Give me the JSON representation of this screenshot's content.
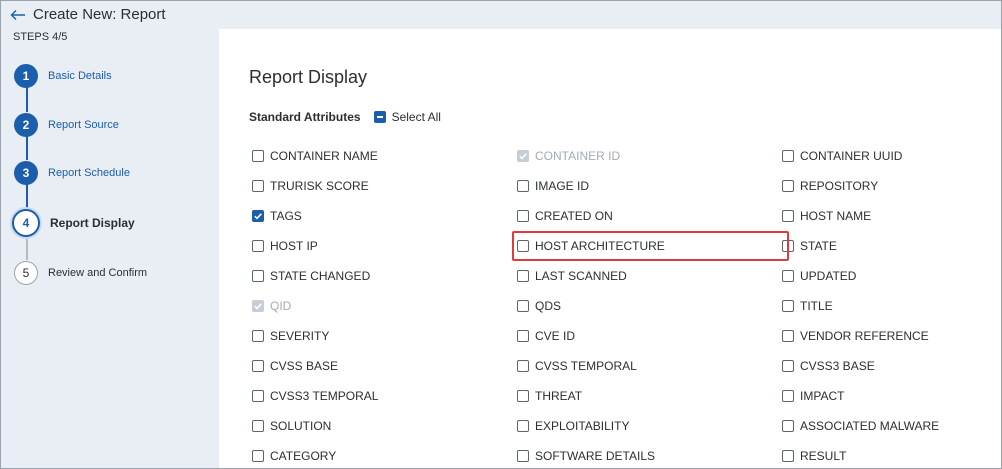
{
  "header": {
    "title": "Create New: Report"
  },
  "sidebar": {
    "steps_label": "STEPS 4/5",
    "steps": [
      {
        "num": "1",
        "label": "Basic Details",
        "state": "done"
      },
      {
        "num": "2",
        "label": "Report Source",
        "state": "done"
      },
      {
        "num": "3",
        "label": "Report Schedule",
        "state": "done"
      },
      {
        "num": "4",
        "label": "Report Display",
        "state": "active"
      },
      {
        "num": "5",
        "label": "Review and Confirm",
        "state": "pending"
      }
    ]
  },
  "main": {
    "section_title": "Report Display",
    "standard_attributes": "Standard Attributes",
    "select_all": "Select All",
    "attributes": [
      {
        "label": "CONTAINER NAME",
        "checked": false,
        "disabled": false
      },
      {
        "label": "CONTAINER ID",
        "checked": true,
        "disabled": true
      },
      {
        "label": "CONTAINER UUID",
        "checked": false,
        "disabled": false
      },
      {
        "label": "TRURISK SCORE",
        "checked": false,
        "disabled": false
      },
      {
        "label": "IMAGE ID",
        "checked": false,
        "disabled": false
      },
      {
        "label": "REPOSITORY",
        "checked": false,
        "disabled": false
      },
      {
        "label": "TAGS",
        "checked": true,
        "disabled": false
      },
      {
        "label": "CREATED ON",
        "checked": false,
        "disabled": false
      },
      {
        "label": "HOST NAME",
        "checked": false,
        "disabled": false
      },
      {
        "label": "HOST IP",
        "checked": false,
        "disabled": false
      },
      {
        "label": "HOST ARCHITECTURE",
        "checked": false,
        "disabled": false,
        "highlighted": true
      },
      {
        "label": "STATE",
        "checked": false,
        "disabled": false
      },
      {
        "label": "STATE CHANGED",
        "checked": false,
        "disabled": false
      },
      {
        "label": "LAST SCANNED",
        "checked": false,
        "disabled": false
      },
      {
        "label": "UPDATED",
        "checked": false,
        "disabled": false
      },
      {
        "label": "QID",
        "checked": true,
        "disabled": true
      },
      {
        "label": "QDS",
        "checked": false,
        "disabled": false
      },
      {
        "label": "TITLE",
        "checked": false,
        "disabled": false
      },
      {
        "label": "SEVERITY",
        "checked": false,
        "disabled": false
      },
      {
        "label": "CVE ID",
        "checked": false,
        "disabled": false
      },
      {
        "label": "VENDOR REFERENCE",
        "checked": false,
        "disabled": false
      },
      {
        "label": "CVSS BASE",
        "checked": false,
        "disabled": false
      },
      {
        "label": "CVSS TEMPORAL",
        "checked": false,
        "disabled": false
      },
      {
        "label": "CVSS3 BASE",
        "checked": false,
        "disabled": false
      },
      {
        "label": "CVSS3 TEMPORAL",
        "checked": false,
        "disabled": false
      },
      {
        "label": "THREAT",
        "checked": false,
        "disabled": false
      },
      {
        "label": "IMPACT",
        "checked": false,
        "disabled": false
      },
      {
        "label": "SOLUTION",
        "checked": false,
        "disabled": false
      },
      {
        "label": "EXPLOITABILITY",
        "checked": false,
        "disabled": false
      },
      {
        "label": "ASSOCIATED MALWARE",
        "checked": false,
        "disabled": false
      },
      {
        "label": "CATEGORY",
        "checked": false,
        "disabled": false
      },
      {
        "label": "SOFTWARE DETAILS",
        "checked": false,
        "disabled": false
      },
      {
        "label": "RESULT",
        "checked": false,
        "disabled": false
      }
    ]
  },
  "colors": {
    "accent": "#1b5eab",
    "highlight": "#e0393e",
    "sidebar_bg": "#e9eef5"
  },
  "icons": {
    "back": "arrow-left-icon",
    "check": "check-icon",
    "minus": "minus-icon"
  }
}
